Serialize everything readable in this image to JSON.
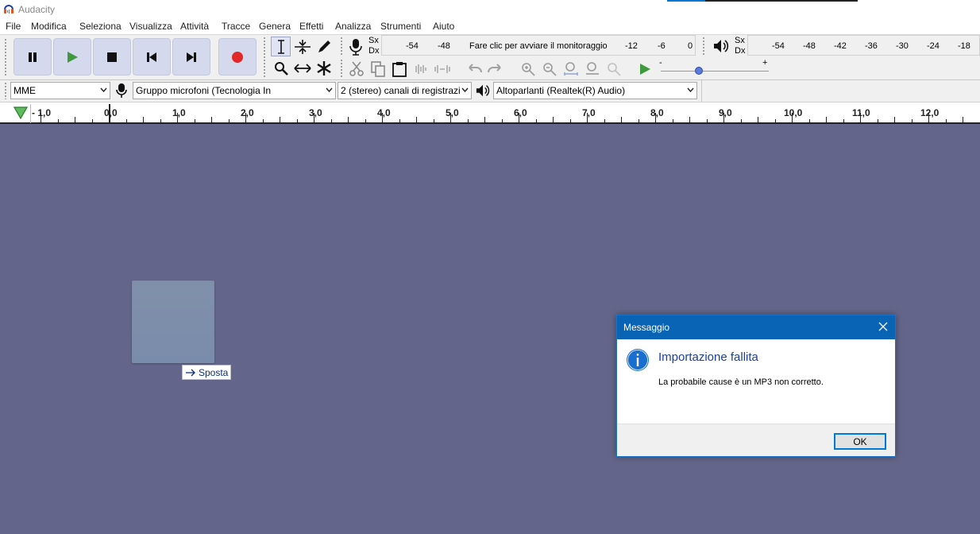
{
  "window": {
    "title": "Audacity"
  },
  "menu": [
    "File",
    "Modifica",
    "Seleziona",
    "Visualizza",
    "Attività",
    "Tracce",
    "Genera",
    "Effetti",
    "Analizza",
    "Strumenti",
    "Aiuto"
  ],
  "recording_meter": {
    "channel_top": "Sx",
    "channel_bottom": "Dx",
    "scale": [
      "-54",
      "-48",
      "Fare clic per avviare il monitoraggio",
      "-12",
      "-6",
      "0"
    ]
  },
  "playback_meter": {
    "channel_top": "Sx",
    "channel_bottom": "Dx",
    "scale": [
      "-54",
      "-48",
      "-42",
      "-36",
      "-30",
      "-24",
      "-18"
    ]
  },
  "play_speed": {
    "minus": "-",
    "plus": "+",
    "level": 0.35
  },
  "device_toolbar": {
    "host": "MME",
    "recording_device": "Gruppo microfoni (Tecnologia In",
    "channels": "2 (stereo) canali di registrazi",
    "playback_device": "Altoparlanti (Realtek(R) Audio)"
  },
  "timeline": {
    "labels": [
      "- 1,0",
      "0,0",
      "1,0",
      "2,0",
      "3,0",
      "4,0",
      "5,0",
      "6,0",
      "7,0",
      "8,0",
      "9,0",
      "10,0",
      "11,0",
      "12,0"
    ]
  },
  "drag_tooltip": {
    "label": "Sposta"
  },
  "dialog": {
    "title": "Messaggio",
    "heading": "Importazione fallita",
    "message": "La probabile cause è un MP3 non corretto.",
    "ok_label": "OK"
  },
  "colors": {
    "workspace": "#63658a",
    "dialog_title_bar": "#0a64b6",
    "record": "#e12727",
    "play": "#3f9a3f"
  }
}
